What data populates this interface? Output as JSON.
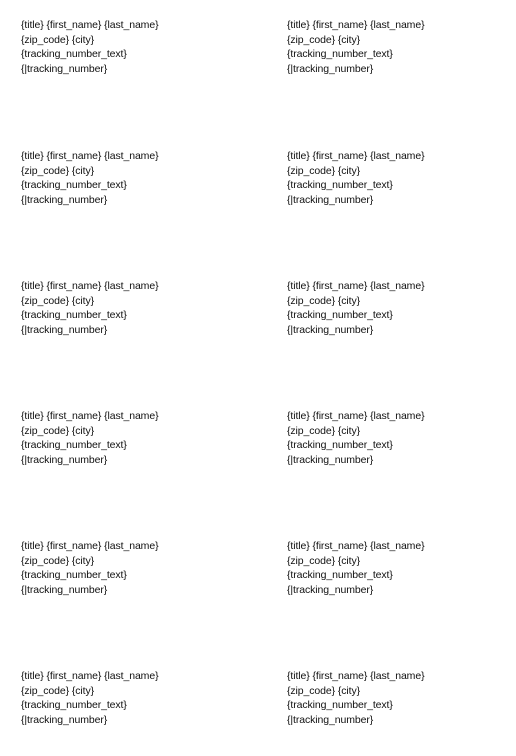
{
  "labels": [
    {
      "line1": "{title} {first_name} {last_name}",
      "line2": "{zip_code} {city}",
      "line3": "{tracking_number_text}",
      "line4": "{|tracking_number}"
    },
    {
      "line1": "{title} {first_name} {last_name}",
      "line2": "{zip_code} {city}",
      "line3": "{tracking_number_text}",
      "line4": "{|tracking_number}"
    },
    {
      "line1": "{title} {first_name} {last_name}",
      "line2": "{zip_code} {city}",
      "line3": "{tracking_number_text}",
      "line4": "{|tracking_number}"
    },
    {
      "line1": "{title} {first_name} {last_name}",
      "line2": "{zip_code} {city}",
      "line3": "{tracking_number_text}",
      "line4": "{|tracking_number}"
    },
    {
      "line1": "{title} {first_name} {last_name}",
      "line2": "{zip_code} {city}",
      "line3": "{tracking_number_text}",
      "line4": "{|tracking_number}"
    },
    {
      "line1": "{title} {first_name} {last_name}",
      "line2": "{zip_code} {city}",
      "line3": "{tracking_number_text}",
      "line4": "{|tracking_number}"
    },
    {
      "line1": "{title} {first_name} {last_name}",
      "line2": "{zip_code} {city}",
      "line3": "{tracking_number_text}",
      "line4": "{|tracking_number}"
    },
    {
      "line1": "{title} {first_name} {last_name}",
      "line2": "{zip_code} {city}",
      "line3": "{tracking_number_text}",
      "line4": "{|tracking_number}"
    },
    {
      "line1": "{title} {first_name} {last_name}",
      "line2": "{zip_code} {city}",
      "line3": "{tracking_number_text}",
      "line4": "{|tracking_number}"
    },
    {
      "line1": "{title} {first_name} {last_name}",
      "line2": "{zip_code} {city}",
      "line3": "{tracking_number_text}",
      "line4": "{|tracking_number}"
    },
    {
      "line1": "{title} {first_name} {last_name}",
      "line2": "{zip_code} {city}",
      "line3": "{tracking_number_text}",
      "line4": "{|tracking_number}"
    },
    {
      "line1": "{title} {first_name} {last_name}",
      "line2": "{zip_code} {city}",
      "line3": "{tracking_number_text}",
      "line4": "{|tracking_number}"
    }
  ]
}
